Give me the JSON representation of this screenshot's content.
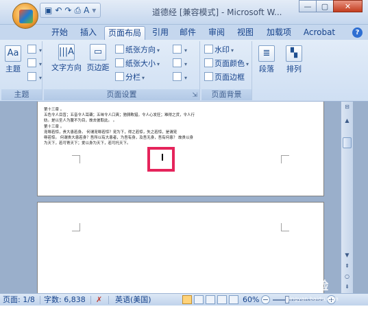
{
  "window": {
    "title": "道德经 [兼容模式] - Microsoft W...",
    "minimize_label": "—",
    "maximize_label": "▢",
    "close_label": "✕"
  },
  "qat": {
    "save": "▣",
    "undo": "↶",
    "redo": "↷",
    "preview": "⎙",
    "format": "A",
    "more": "▾"
  },
  "tabs": [
    {
      "label": "开始"
    },
    {
      "label": "插入"
    },
    {
      "label": "页面布局"
    },
    {
      "label": "引用"
    },
    {
      "label": "邮件"
    },
    {
      "label": "审阅"
    },
    {
      "label": "视图"
    },
    {
      "label": "加载项"
    },
    {
      "label": "Acrobat"
    }
  ],
  "active_tab": "页面布局",
  "ribbon": {
    "theme": {
      "themes_label": "主题",
      "group_label": "主题"
    },
    "page_setup": {
      "text_direction": "文字方向",
      "margins": "页边距",
      "orientation": "纸张方向",
      "size": "纸张大小",
      "columns": "分栏",
      "group_label": "页面设置"
    },
    "page_background": {
      "watermark": "水印",
      "page_color": "页面颜色",
      "page_borders": "页面边框",
      "group_label": "页面背景"
    },
    "paragraph": {
      "label": "段落"
    },
    "arrange": {
      "label": "排列"
    }
  },
  "document": {
    "lines": [
      "第十三章 。",
      "五色令人目盲；五音令人耳聋；五味令人口爽；驰骋畋猎，令人心发狂；难得之货，令人行",
      "妨。是以圣人为腹不为目，故去彼取此。 。",
      "第十三章 。",
      "宠辱若惊，贵大患若身。 何谓宠辱若惊？宠为下，得之若惊，失之若惊，是谓宠",
      "辱若惊。 何谓贵大患若身？吾所以有大患者，为吾有身，及吾无身，吾有何患？ 故贵以身",
      "为天下，若可寄天下；爱以身为天下，若可托天下。"
    ]
  },
  "status": {
    "page": "页面: 1/8",
    "words": "字数: 6,838",
    "language": "英语(美国)",
    "zoom": "60%",
    "zoom_level_percent": 60
  },
  "watermark": {
    "text": "Bai度经验",
    "url": "jingyan.baidu.com"
  },
  "colors": {
    "highlight": "#e5245b",
    "ribbon": "#cfdff3",
    "doc_bg": "#9aafcb"
  }
}
